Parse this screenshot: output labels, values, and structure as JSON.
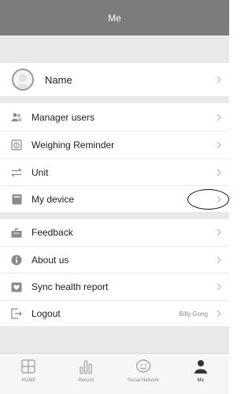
{
  "header": {
    "title": "Me"
  },
  "profile": {
    "name": "Name",
    "icon": "avatar-icon"
  },
  "menu_group_1": [
    {
      "label": "Manager users",
      "icon": "users-icon"
    },
    {
      "label": "Weighing Reminder",
      "icon": "alarm-clock-icon"
    },
    {
      "label": "Unit",
      "icon": "swap-arrows-icon"
    },
    {
      "label": "My device",
      "icon": "device-icon"
    }
  ],
  "menu_group_2": [
    {
      "label": "Feedback",
      "icon": "mailbox-icon"
    },
    {
      "label": "About us",
      "icon": "info-icon"
    },
    {
      "label": "Sync health report",
      "icon": "heart-report-icon"
    },
    {
      "label": "Logout",
      "icon": "logout-icon",
      "value": "Billy Gong"
    }
  ],
  "tabbar": {
    "tabs": [
      {
        "label": "HOME",
        "icon": "grid-home-icon",
        "active": false
      },
      {
        "label": "Record",
        "icon": "bar-chart-icon",
        "active": false
      },
      {
        "label": "Social Network",
        "icon": "smiley-icon",
        "active": false
      },
      {
        "label": "Me",
        "icon": "person-icon",
        "active": true
      }
    ]
  },
  "colors": {
    "header_bg": "#7c7c7c",
    "section_gap": "#e9e9e9",
    "icon": "#8a8a8a",
    "chevron": "#b0b0b0"
  }
}
